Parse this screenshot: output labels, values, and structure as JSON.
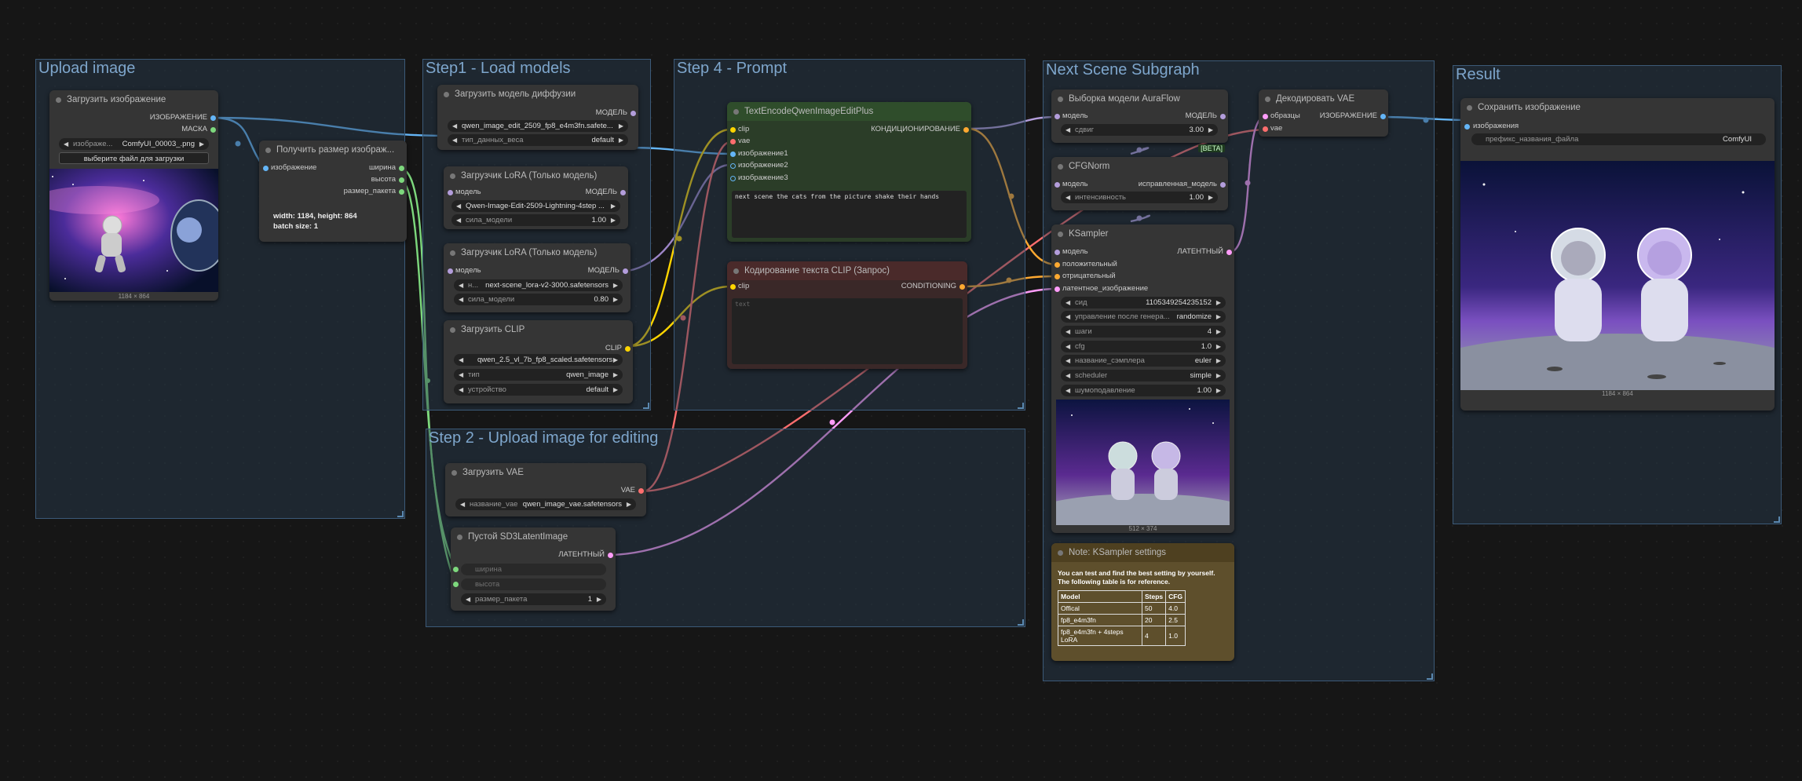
{
  "groups": {
    "upload": "Upload image",
    "step1": "Step1 - Load models",
    "step4": "Step 4 - Prompt",
    "nextscene": "Next Scene Subgraph",
    "result": "Result",
    "step2": "Step 2 - Upload image for editing"
  },
  "load_image": {
    "title": "Загрузить изображение",
    "out_image": "ИЗОБРАЖЕНИЕ",
    "out_mask": "МАСКА",
    "image_label": "изображе...",
    "image_value": "ComfyUI_00003_.png",
    "upload_button": "выберите файл для загрузки",
    "caption": "1184 × 864"
  },
  "get_size": {
    "title": "Получить размер изображ...",
    "in_image": "изображение",
    "out_width": "ширина",
    "out_height": "высота",
    "out_batch": "размер_пакета",
    "info1": "width: 1184, height: 864",
    "info2": "batch size: 1"
  },
  "load_diffusion": {
    "title": "Загрузить модель диффузии",
    "out_model": "МОДЕЛЬ",
    "unet_value": "qwen_image_edit_2509_fp8_e4m3fn.safete...",
    "dtype_label": "тип_данных_веса",
    "dtype_value": "default"
  },
  "lora1": {
    "title": "Загрузчик LoRA (Только модель)",
    "in_model": "модель",
    "out_model": "МОДЕЛЬ",
    "lora_value": "Qwen-Image-Edit-2509-Lightning-4step ...",
    "strength_label": "сила_модели",
    "strength_value": "1.00"
  },
  "lora2": {
    "title": "Загрузчик LoRA (Только модель)",
    "in_model": "модель",
    "out_model": "МОДЕЛЬ",
    "lora_label": "н...",
    "lora_value": "next-scene_lora-v2-3000.safetensors",
    "strength_label": "сила_модели",
    "strength_value": "0.80"
  },
  "load_clip": {
    "title": "Загрузить CLIP",
    "out_clip": "CLIP",
    "clip_value": "qwen_2.5_vl_7b_fp8_scaled.safetensors",
    "type_label": "тип",
    "type_value": "qwen_image",
    "device_label": "устройство",
    "device_value": "default"
  },
  "text_encode": {
    "title": "TextEncodeQwenImageEditPlus",
    "in_clip": "clip",
    "in_vae": "vae",
    "in_image1": "изображение1",
    "in_image2": "изображение2",
    "in_image3": "изображение3",
    "out_cond": "КОНДИЦИОНИРОВАНИЕ",
    "prompt": "next scene the cats from the picture shake their hands"
  },
  "clip_text": {
    "title": "Кодирование текста CLIP (Запрос)",
    "in_clip": "clip",
    "out_cond": "CONDITIONING",
    "placeholder": "text"
  },
  "aura_flow": {
    "title": "Выборка модели AuraFlow",
    "in_model": "модель",
    "out_model": "МОДЕЛЬ",
    "shift_label": "сдвиг",
    "shift_value": "3.00",
    "badge": "[BETA]"
  },
  "cfgnorm": {
    "title": "CFGNorm",
    "in_model": "модель",
    "out_model": "исправленная_модель",
    "strength_label": "интенсивность",
    "strength_value": "1.00"
  },
  "vae_decode": {
    "title": "Декодировать VAE",
    "in_samples": "образцы",
    "in_vae": "vae",
    "out_image": "ИЗОБРАЖЕНИЕ"
  },
  "ksampler": {
    "title": "KSampler",
    "in_model": "модель",
    "in_pos": "положительный",
    "in_neg": "отрицательный",
    "in_latent": "латентное_изображение",
    "out_latent": "ЛАТЕНТНЫЙ",
    "seed_label": "сид",
    "seed_value": "1105349254235152",
    "control_label": "управление после генера...",
    "control_value": "randomize",
    "steps_label": "шаги",
    "steps_value": "4",
    "cfg_label": "cfg",
    "cfg_value": "1.0",
    "sampler_label": "название_сэмплера",
    "sampler_value": "euler",
    "scheduler_label": "scheduler",
    "scheduler_value": "simple",
    "denoise_label": "шумоподавление",
    "denoise_value": "1.00",
    "caption": "512 × 374"
  },
  "save_image": {
    "title": "Сохранить изображение",
    "in_images": "изображения",
    "prefix_label": "префикс_названия_файла",
    "prefix_value": "ComfyUI",
    "caption": "1184 × 864"
  },
  "load_vae": {
    "title": "Загрузить VAE",
    "out_vae": "VAE",
    "vae_label": "название_vae",
    "vae_value": "qwen_image_vae.safetensors"
  },
  "empty_latent": {
    "title": "Пустой SD3LatentImage",
    "out_latent": "ЛАТЕНТНЫЙ",
    "width_label": "ширина",
    "height_label": "высота",
    "batch_label": "размер_пакета",
    "batch_value": "1"
  },
  "note": {
    "title": "Note: KSampler settings",
    "text": "You can test and find the best setting by yourself. The following table is for reference.",
    "table": {
      "headers": [
        "Model",
        "Steps",
        "CFG"
      ],
      "rows": [
        [
          "Offical",
          "50",
          "4.0"
        ],
        [
          "fp8_e4m3fn",
          "20",
          "2.5"
        ],
        [
          "fp8_e4m3fn + 4steps LoRA",
          "4",
          "1.0"
        ]
      ]
    }
  },
  "colors": {
    "model": "#b39ddb",
    "clip": "#ffd500",
    "vae": "#ff6e6e",
    "image": "#64b5f6",
    "latent": "#ff9cf9",
    "conditioning": "#ffa931",
    "int": "#7dd87d"
  }
}
